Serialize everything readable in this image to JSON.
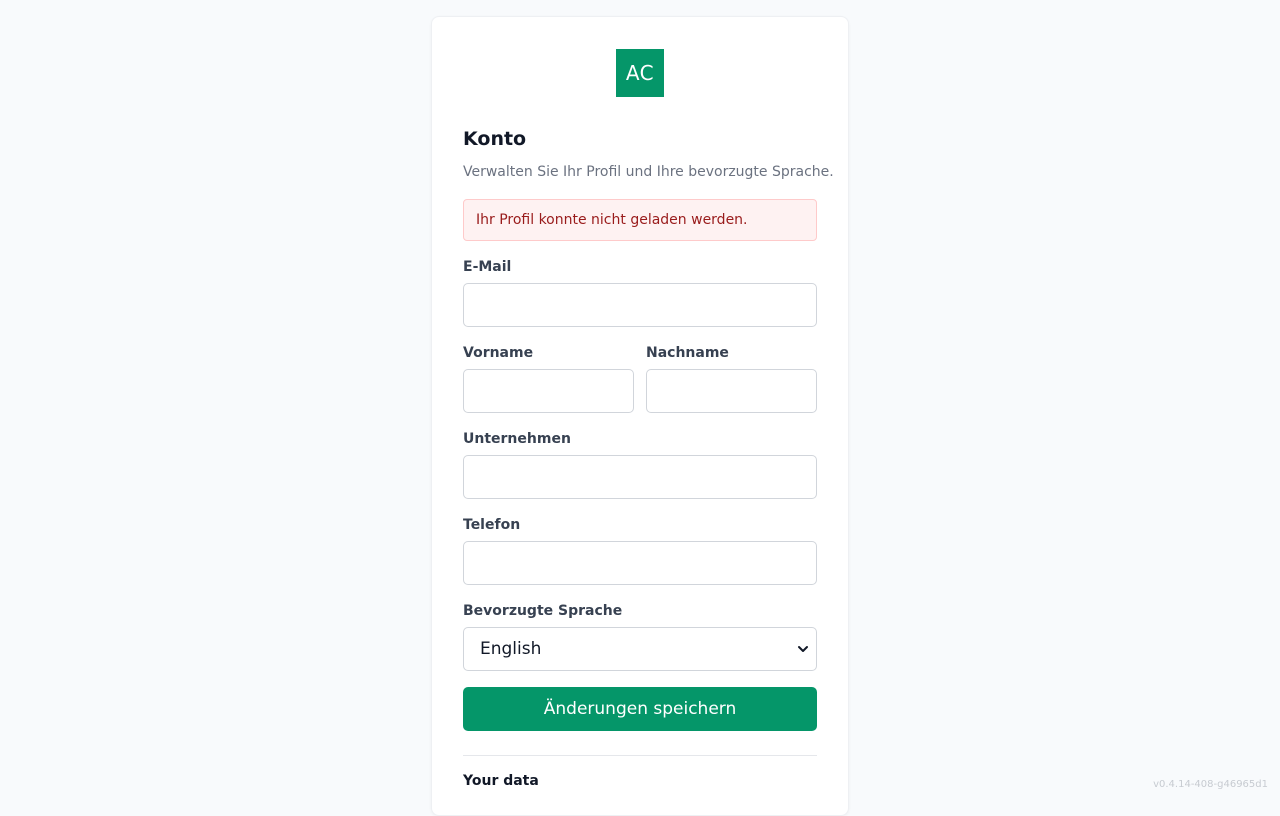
{
  "logo": {
    "text": "AC",
    "color": "#059669"
  },
  "header": {
    "title": "Konto",
    "subtitle": "Verwalten Sie Ihr Profil und Ihre bevorzugte Sprache."
  },
  "alert": {
    "message": "Ihr Profil konnte nicht geladen werden."
  },
  "form": {
    "email": {
      "label": "E-Mail",
      "value": ""
    },
    "first_name": {
      "label": "Vorname",
      "value": ""
    },
    "last_name": {
      "label": "Nachname",
      "value": ""
    },
    "company": {
      "label": "Unternehmen",
      "value": ""
    },
    "phone": {
      "label": "Telefon",
      "value": ""
    },
    "language": {
      "label": "Bevorzugte Sprache",
      "selected": "English"
    },
    "submit_label": "Änderungen speichern"
  },
  "data_section": {
    "title": "Your data"
  },
  "footer": {
    "version": "v0.4.14-408-g46965d1"
  },
  "colors": {
    "accent": "#059669",
    "alert_bg": "#fef2f2",
    "alert_text": "#991b1b",
    "page_bg": "#f8fafc"
  }
}
